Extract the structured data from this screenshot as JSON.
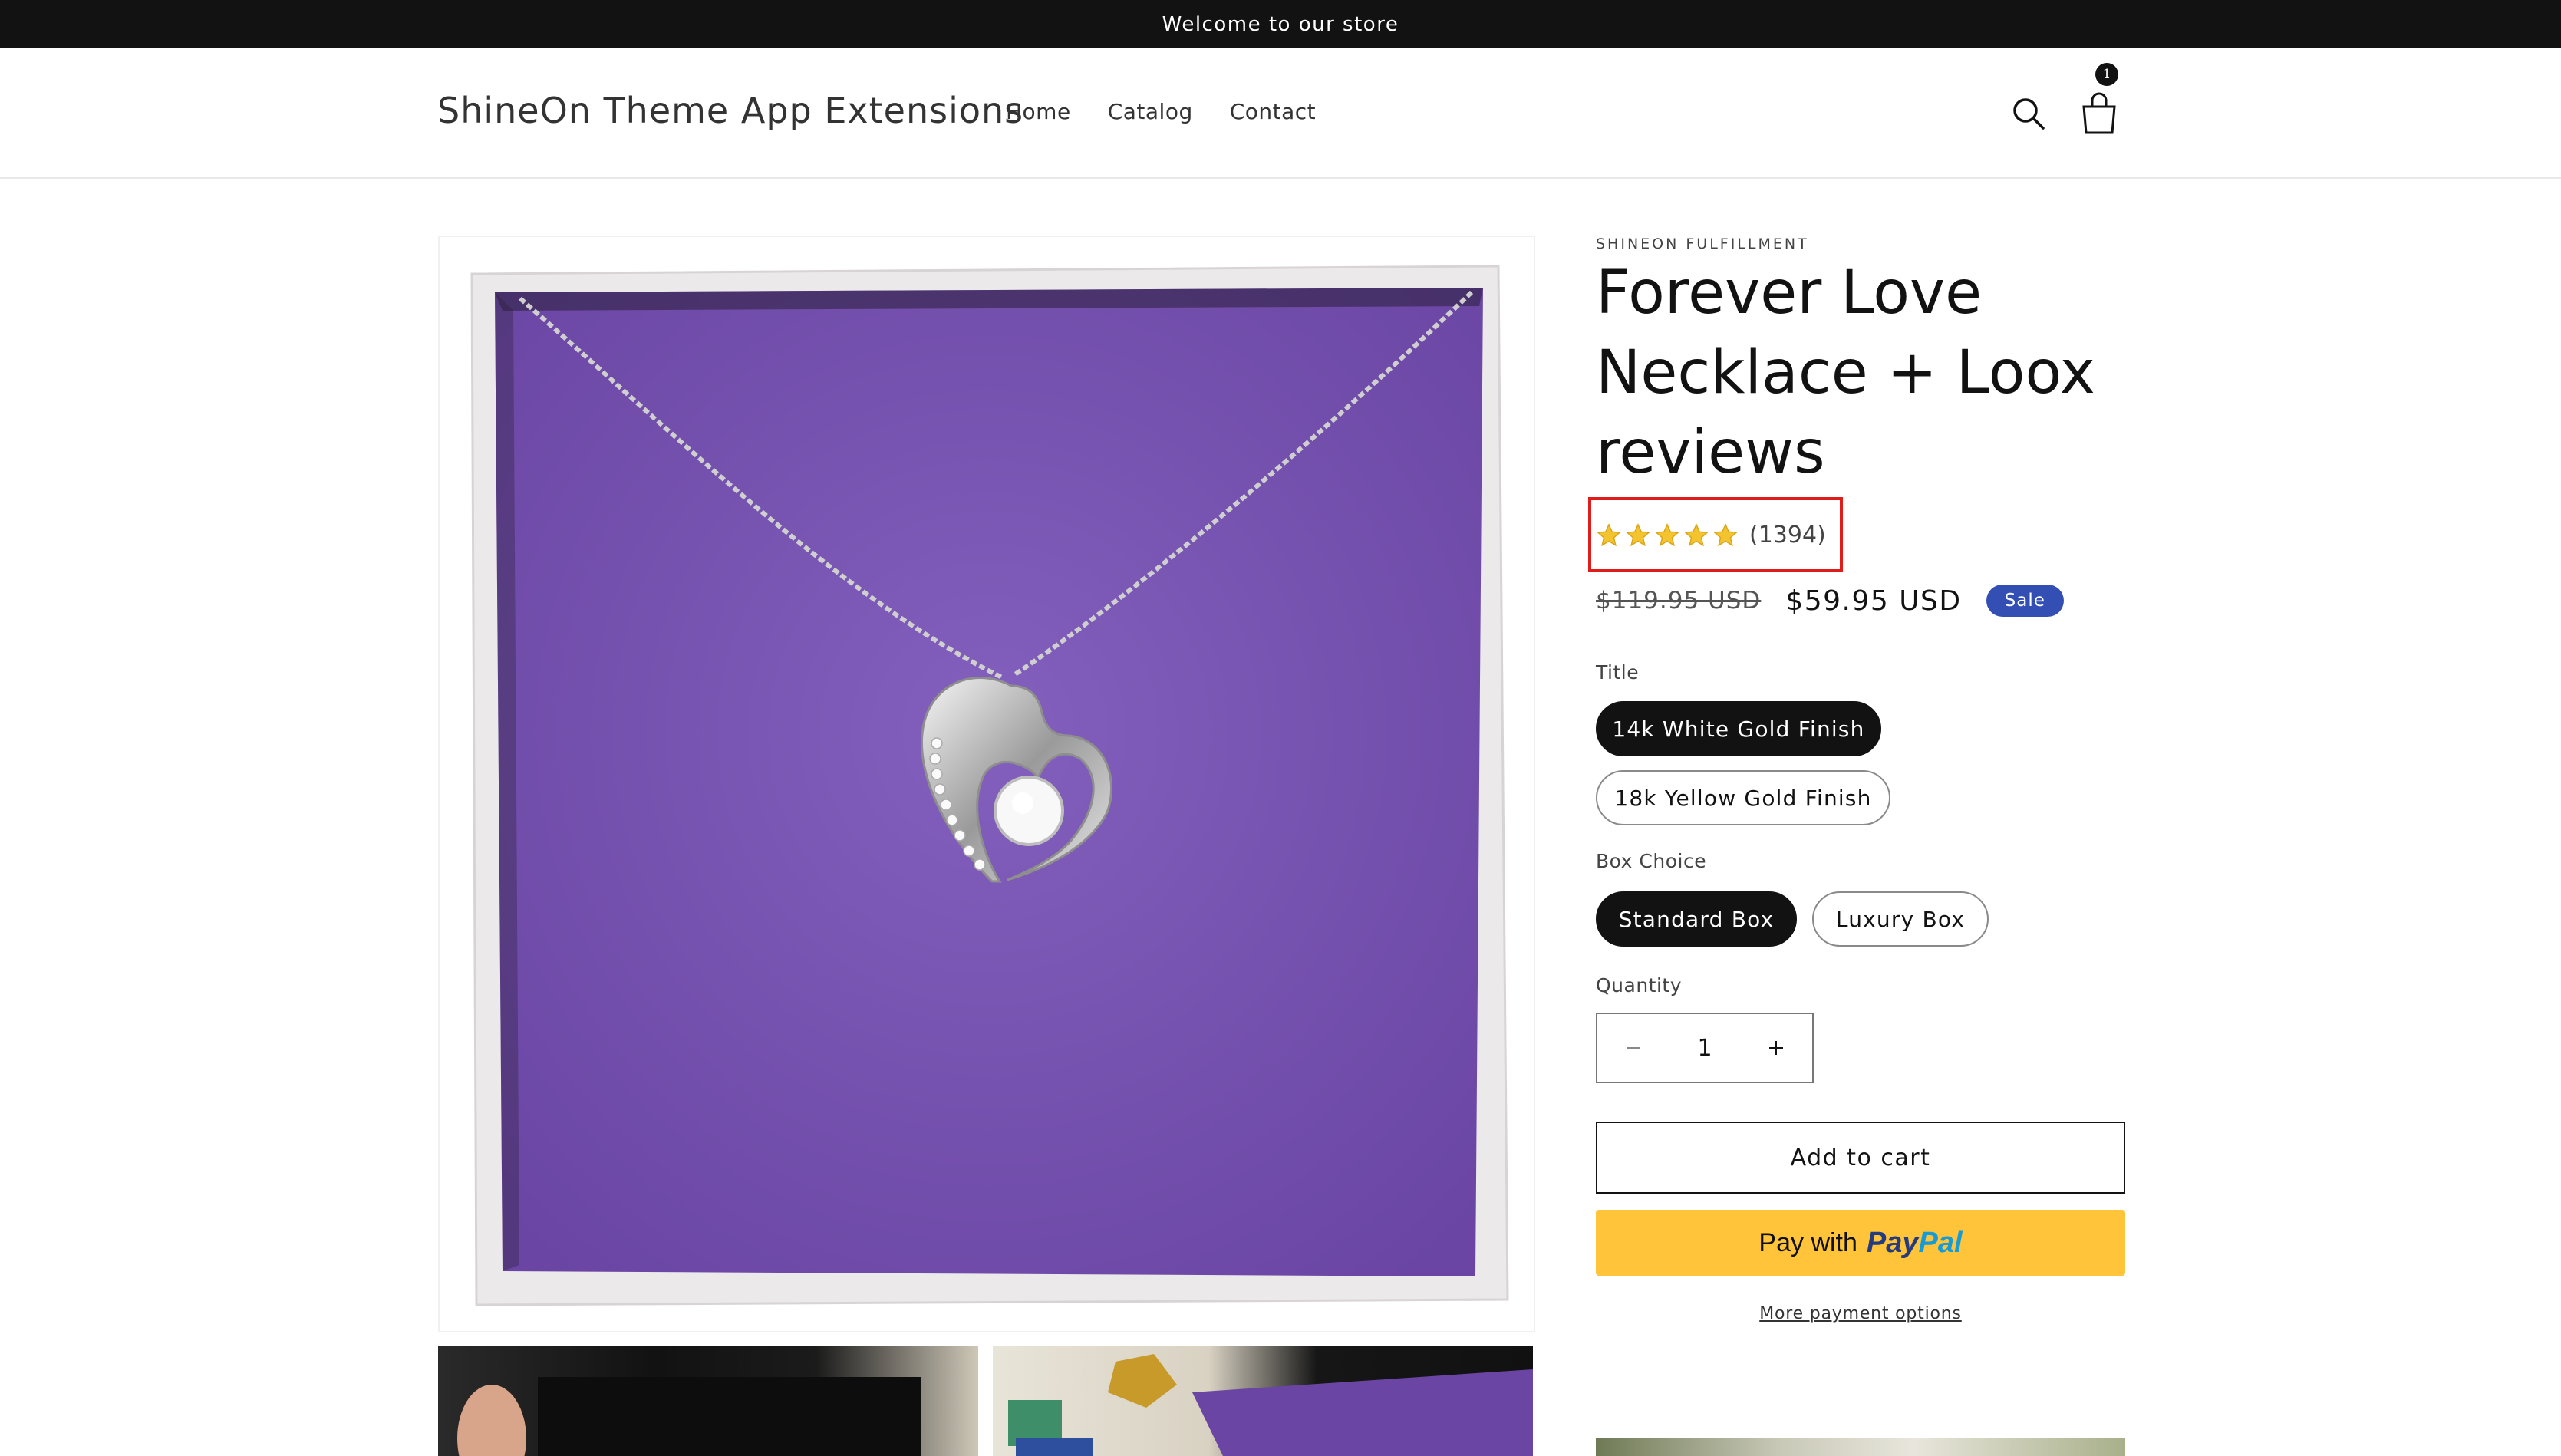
{
  "announcement": {
    "text": "Welcome to our store"
  },
  "header": {
    "logo": "ShineOn Theme App Extensions",
    "nav": [
      "Home",
      "Catalog",
      "Contact"
    ],
    "cart_count": "1"
  },
  "product": {
    "vendor": "SHINEON FULFILLMENT",
    "title": "Forever Love Necklace + Loox reviews",
    "rating": {
      "stars": 5,
      "count_label": "(1394)"
    },
    "price_old": "$119.95 USD",
    "price_new": "$59.95 USD",
    "sale_badge": "Sale",
    "options": {
      "title_label": "Title",
      "title_values": [
        "14k White Gold Finish",
        "18k Yellow Gold Finish"
      ],
      "title_selected": "14k White Gold Finish",
      "box_label": "Box Choice",
      "box_values": [
        "Standard Box",
        "Luxury Box"
      ],
      "box_selected": "Standard Box"
    },
    "quantity_label": "Quantity",
    "quantity_value": "1",
    "add_to_cart": "Add to cart",
    "paypal": {
      "prefix": "Pay with",
      "brand_a": "Pay",
      "brand_b": "Pal"
    },
    "more_payment": "More payment options"
  },
  "colors": {
    "announcement_bg": "#121212",
    "sale_badge": "#334fb4",
    "star": "#f4c430",
    "paypal_bg": "#ffc439",
    "highlight_box": "#e21b1b",
    "box_purple": "#7752b0"
  }
}
